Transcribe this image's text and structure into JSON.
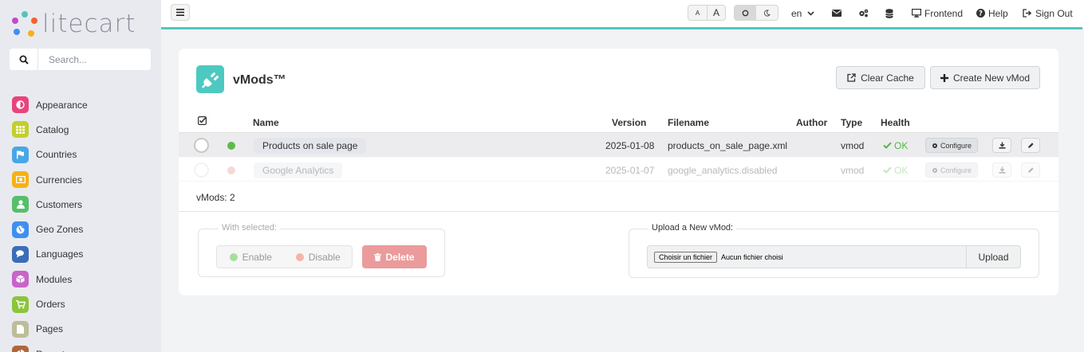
{
  "app": {
    "logo_text": "litecart",
    "search_placeholder": "Search..."
  },
  "sidebar": {
    "items": [
      {
        "label": "Appearance",
        "icon": "appearance-icon",
        "color": "#e8447b"
      },
      {
        "label": "Catalog",
        "icon": "catalog-icon",
        "color": "#c2cf2c"
      },
      {
        "label": "Countries",
        "icon": "flag-icon",
        "color": "#48a7e6"
      },
      {
        "label": "Currencies",
        "icon": "money-icon",
        "color": "#f5b216"
      },
      {
        "label": "Customers",
        "icon": "user-icon",
        "color": "#55bf6a"
      },
      {
        "label": "Geo Zones",
        "icon": "globe-icon",
        "color": "#3f8ff0"
      },
      {
        "label": "Languages",
        "icon": "chat-icon",
        "color": "#3b6db8"
      },
      {
        "label": "Modules",
        "icon": "cube-icon",
        "color": "#c765c8"
      },
      {
        "label": "Orders",
        "icon": "cart-icon",
        "color": "#8bc53a"
      },
      {
        "label": "Pages",
        "icon": "page-icon",
        "color": "#bdbd9a"
      },
      {
        "label": "Reports",
        "icon": "pie-icon",
        "color": "#b0663c"
      }
    ]
  },
  "topbar": {
    "font_small": "A",
    "font_large": "A",
    "language": "en",
    "frontend": "Frontend",
    "help": "Help",
    "sign_out": "Sign Out"
  },
  "page": {
    "title": "vMods™",
    "clear_cache": "Clear Cache",
    "create_new": "Create New vMod"
  },
  "table": {
    "headers": {
      "name": "Name",
      "version": "Version",
      "filename": "Filename",
      "author": "Author",
      "type": "Type",
      "health": "Health"
    },
    "rows": [
      {
        "name": "Products on sale page",
        "version": "2025-01-08",
        "filename": "products_on_sale_page.xml",
        "author": "",
        "type": "vmod",
        "health": "OK",
        "configure": "Configure",
        "status_color": "#5dbb4a"
      },
      {
        "name": "Google Analytics",
        "version": "2025-01-07",
        "filename": "google_analytics.disabled",
        "author": "",
        "type": "vmod",
        "health": "OK",
        "configure": "Configure",
        "status_color": "#f08f8f"
      }
    ],
    "count": "vMods: 2"
  },
  "bulk": {
    "legend": "With selected:",
    "enable": "Enable",
    "disable": "Disable",
    "delete": "Delete"
  },
  "upload": {
    "legend": "Upload a New vMod:",
    "choose_file": "Choisir un fichier",
    "no_file": "Aucun fichier choisi",
    "button": "Upload"
  },
  "colors": {
    "accent": "#4dc9c1",
    "ok": "#52b848",
    "delete": "#eb9b9b"
  }
}
